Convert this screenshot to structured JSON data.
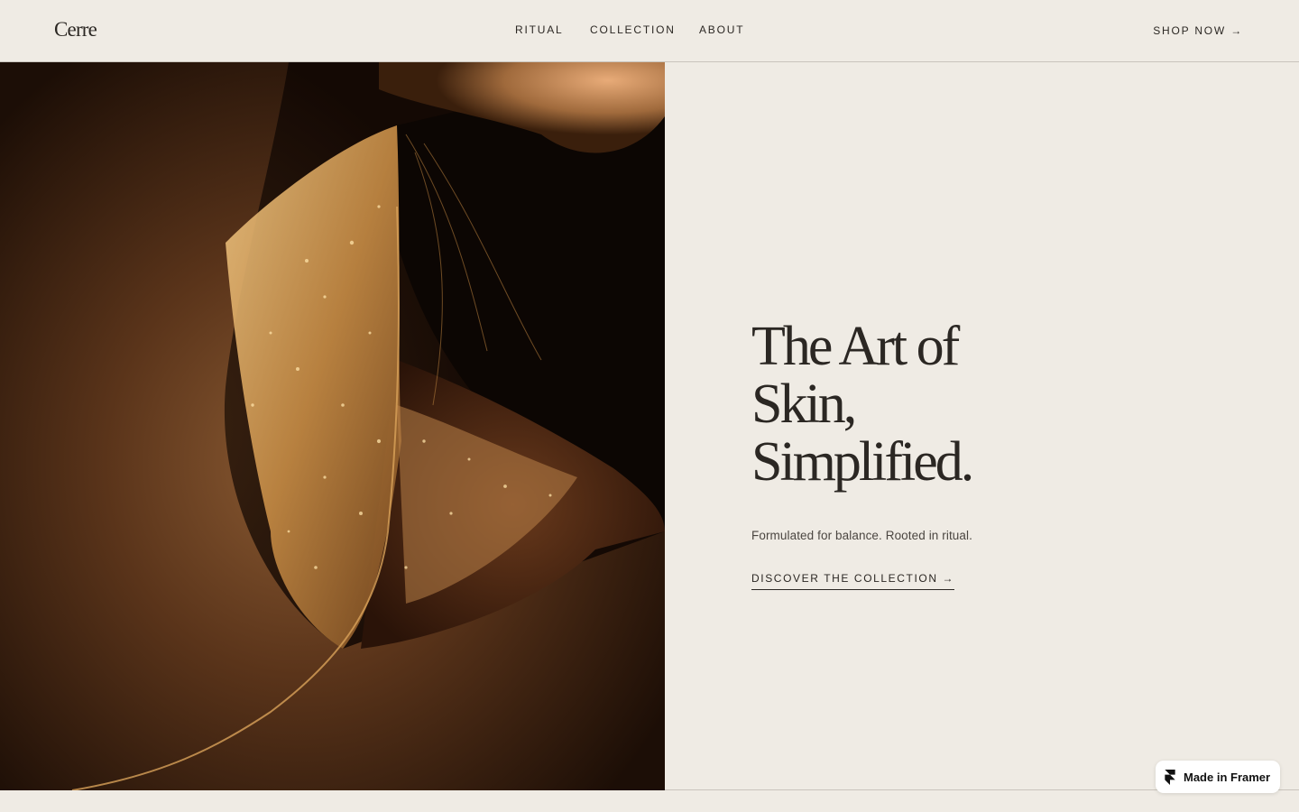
{
  "brand": {
    "logo": "Cerre"
  },
  "nav": {
    "items": [
      {
        "label": "RITUAL"
      },
      {
        "label": "COLLECTION"
      },
      {
        "label": "ABOUT"
      }
    ],
    "cta": "SHOP NOW →"
  },
  "hero": {
    "image_icon": "skin-closeup-photo",
    "headline": [
      "The Art of",
      "Skin,",
      "Simplified."
    ],
    "tagline": "Formulated for balance. Rooted in ritual.",
    "cta": "DISCOVER THE COLLECTION →"
  },
  "badge": {
    "label": "Made in Framer",
    "icon": "framer-logo-icon"
  },
  "colors": {
    "background": "#efebe4",
    "text": "#2b2723",
    "divider": "#c9c4bc",
    "image_dark": "#1a0d06",
    "image_gold": "#d9a35a"
  }
}
